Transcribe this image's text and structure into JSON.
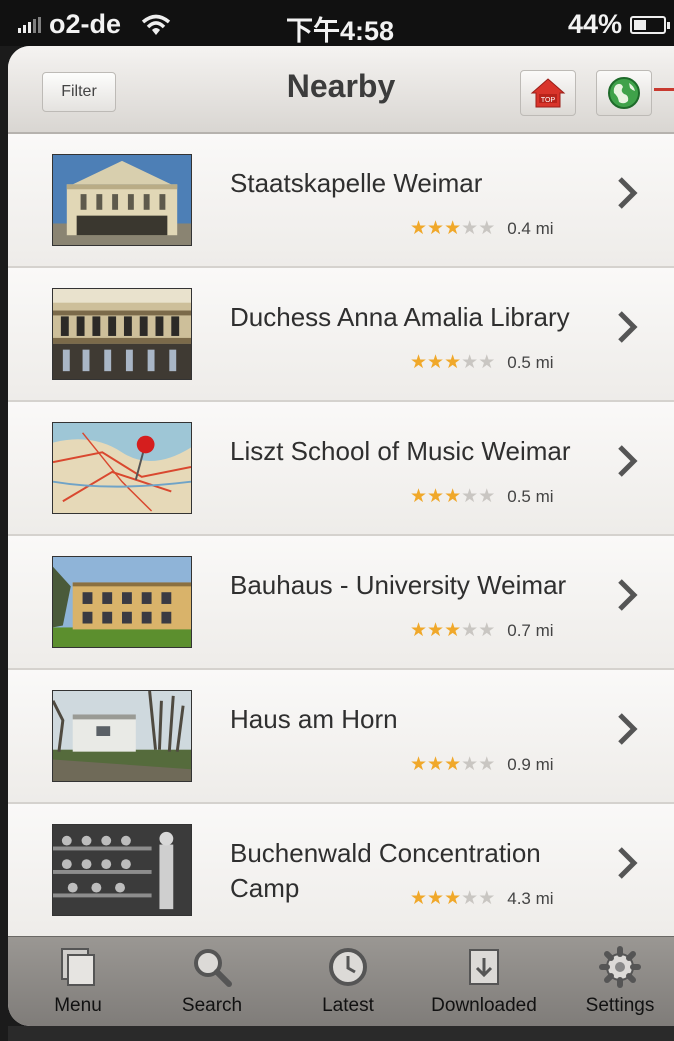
{
  "status_bar": {
    "carrier": "o2-de",
    "time": "下午4:58",
    "battery": "44%",
    "battery_level": 0.44
  },
  "nav": {
    "filter_label": "Filter",
    "title": "Nearby",
    "top_label": "TOP"
  },
  "items": [
    {
      "title": "Staatskapelle Weimar",
      "rating": 3,
      "max_rating": 5,
      "distance": "0.4 mi"
    },
    {
      "title": "Duchess Anna Amalia Library",
      "rating": 3,
      "max_rating": 5,
      "distance": "0.5 mi"
    },
    {
      "title": "Liszt School of Music Weimar",
      "rating": 3,
      "max_rating": 5,
      "distance": "0.5 mi"
    },
    {
      "title": "Bauhaus - University Weimar",
      "rating": 3,
      "max_rating": 5,
      "distance": "0.7 mi"
    },
    {
      "title": "Haus am Horn",
      "rating": 3,
      "max_rating": 5,
      "distance": "0.9 mi"
    },
    {
      "title": "Buchenwald Concentration Camp",
      "rating": 3,
      "max_rating": 5,
      "distance": "4.3 mi"
    }
  ],
  "tabs": [
    {
      "label": "Menu",
      "icon": "menu-icon"
    },
    {
      "label": "Search",
      "icon": "search-icon"
    },
    {
      "label": "Latest",
      "icon": "clock-icon"
    },
    {
      "label": "Downloaded",
      "icon": "download-icon"
    },
    {
      "label": "Settings",
      "icon": "gear-icon"
    }
  ],
  "colors": {
    "star": "#f0a82a",
    "accent_red": "#c8392f",
    "tabbar": "#8c8986"
  }
}
